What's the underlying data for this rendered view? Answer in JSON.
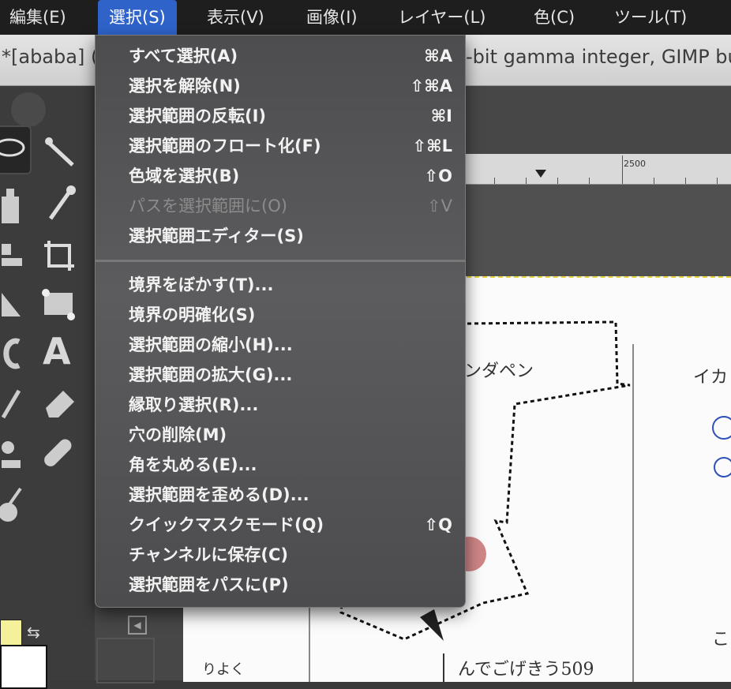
{
  "menubar": {
    "items": [
      {
        "label": "編集(E)"
      },
      {
        "label": "選択(S)"
      },
      {
        "label": "表示(V)"
      },
      {
        "label": "画像(I)"
      },
      {
        "label": "レイヤー(L)"
      },
      {
        "label": "色(C)"
      },
      {
        "label": "ツール(T)"
      }
    ]
  },
  "titlebar": {
    "left_text": "*[ababa] (",
    "right_text": "-bit gamma integer, GIMP bu"
  },
  "ruler": {
    "label": "2500"
  },
  "select_menu": {
    "items": [
      {
        "label": "すべて選択(A)",
        "shortcut": "⌘A",
        "enabled": true
      },
      {
        "label": "選択を解除(N)",
        "shortcut": "⇧⌘A",
        "enabled": true
      },
      {
        "label": "選択範囲の反転(I)",
        "shortcut": "⌘I",
        "enabled": true
      },
      {
        "label": "選択範囲のフロート化(F)",
        "shortcut": "⇧⌘L",
        "enabled": true
      },
      {
        "label": "色域を選択(B)",
        "shortcut": "⇧O",
        "enabled": true
      },
      {
        "label": "パスを選択範囲に(O)",
        "shortcut": "⇧V",
        "enabled": false
      },
      {
        "label": "選択範囲エディター(S)",
        "shortcut": "",
        "enabled": true
      },
      {
        "label": "境界をぼかす(T)...",
        "shortcut": "",
        "enabled": true
      },
      {
        "label": "境界の明確化(S)",
        "shortcut": "",
        "enabled": true
      },
      {
        "label": "選択範囲の縮小(H)...",
        "shortcut": "",
        "enabled": true
      },
      {
        "label": "選択範囲の拡大(G)...",
        "shortcut": "",
        "enabled": true
      },
      {
        "label": "縁取り選択(R)...",
        "shortcut": "",
        "enabled": true
      },
      {
        "label": "穴の削除(M)",
        "shortcut": "",
        "enabled": true
      },
      {
        "label": "角を丸める(E)...",
        "shortcut": "",
        "enabled": true
      },
      {
        "label": "選択範囲を歪める(D)...",
        "shortcut": "",
        "enabled": true
      },
      {
        "label": "クイックマスクモード(Q)",
        "shortcut": "⇧Q",
        "enabled": true
      },
      {
        "label": "チャンネルに保存(C)",
        "shortcut": "",
        "enabled": true
      },
      {
        "label": "選択範囲をパスに(P)",
        "shortcut": "",
        "enabled": true
      }
    ]
  },
  "canvas_text": {
    "a": "ンダペン",
    "b": "イカ",
    "c": "りよく",
    "d": "んでごげきう509",
    "e": "こ"
  },
  "colors": {
    "menu_bg": "#555557",
    "accent": "#2f63c9",
    "foreground": "#f4f19a",
    "background": "#ffffff"
  }
}
